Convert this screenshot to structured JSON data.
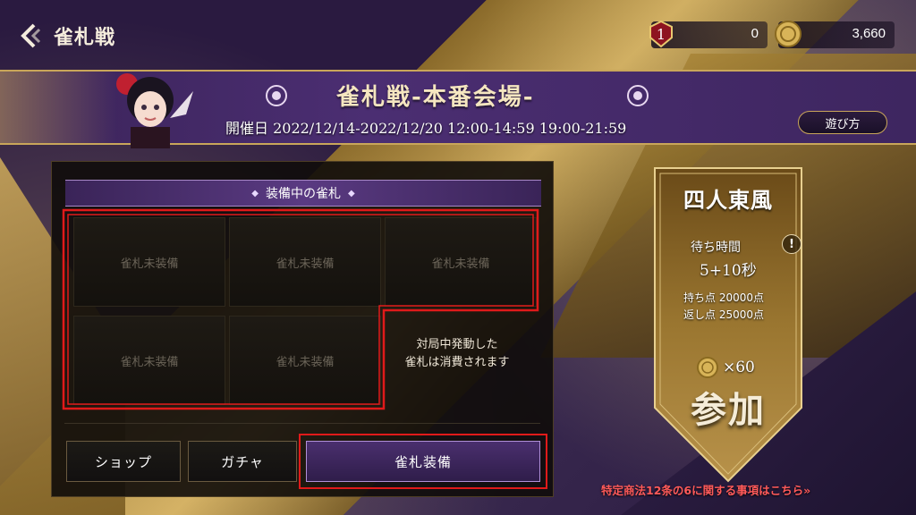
{
  "header": {
    "title": "雀札戦",
    "back_icon": "chevron-left-icon"
  },
  "currencies": {
    "ticket": {
      "icon": "ticket-icon",
      "value": "0"
    },
    "coin": {
      "icon": "coin-icon",
      "value": "3,660"
    }
  },
  "banner": {
    "title": "雀札戦-本番会場-",
    "date_text": "開催日 2022/12/14-2022/12/20 12:00-14:59 19:00-21:59",
    "howto_label": "遊び方"
  },
  "equipped": {
    "header": "装備中の雀札",
    "slots": [
      "雀札未装備",
      "雀札未装備",
      "雀札未装備",
      "雀札未装備",
      "雀札未装備"
    ],
    "note_line1": "対局中発動した",
    "note_line2": "雀札は消費されます"
  },
  "buttons": {
    "shop": "ショップ",
    "gacha": "ガチャ",
    "equip": "雀札装備"
  },
  "mode": {
    "title": "四人東風",
    "wait_label": "待ち時間",
    "wait_value": "5+10秒",
    "start_points": "持ち点 20000点",
    "return_points": "返し点 25000点",
    "cost": "×60",
    "join_label": "参加"
  },
  "legal_link": "特定商法12条の6に関する事項はこちら",
  "colors": {
    "accent_gold": "#c9a65a",
    "highlight_red": "#e01a1a",
    "equip_purple": "#4a2f6e"
  }
}
